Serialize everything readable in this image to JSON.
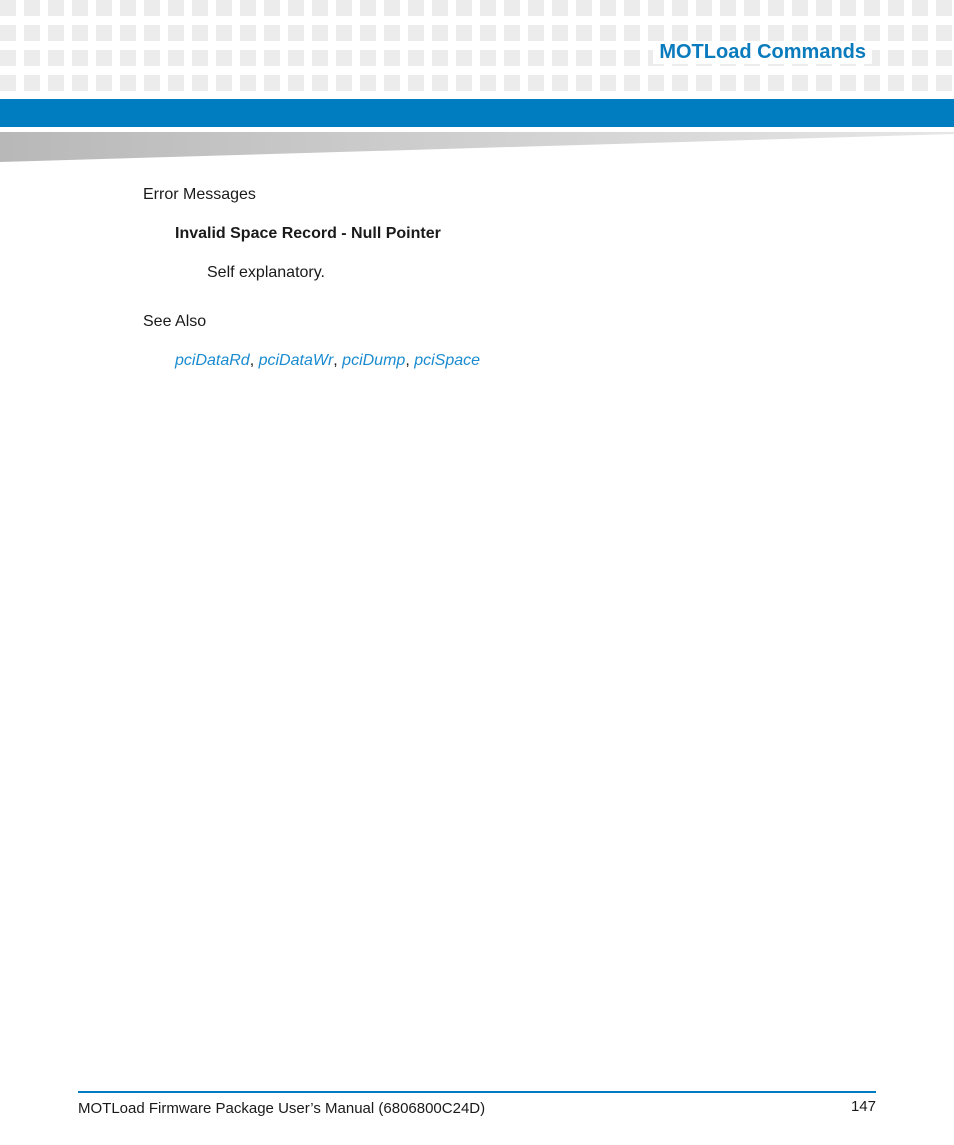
{
  "header": {
    "title": "MOTLoad Commands",
    "accent_color": "#007dc1",
    "title_color": "#0a7bbd"
  },
  "sections": {
    "error_messages": {
      "heading": "Error Messages",
      "term": "Invalid Space Record - Null Pointer",
      "description": "Self explanatory."
    },
    "see_also": {
      "heading": "See Also",
      "links": [
        "pciDataRd",
        "pciDataWr",
        "pciDump",
        "pciSpace"
      ],
      "separator": ", ",
      "link_color": "#1a8bd0"
    }
  },
  "footer": {
    "manual_title": "MOTLoad Firmware Package User’s Manual (6806800C24D)",
    "page_number": "147"
  }
}
